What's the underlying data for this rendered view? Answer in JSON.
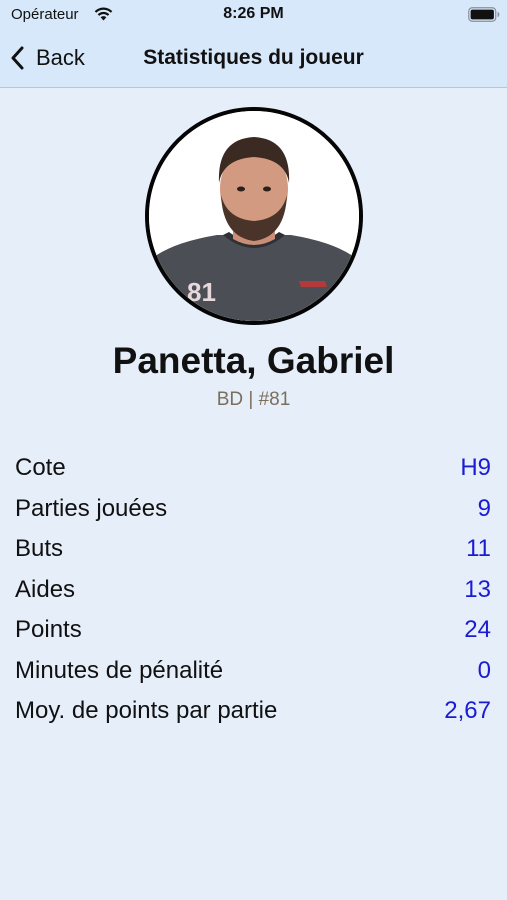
{
  "status_bar": {
    "carrier": "Opérateur",
    "time": "8:26 PM"
  },
  "nav": {
    "back_label": "Back",
    "title": "Statistiques du joueur"
  },
  "player": {
    "name": "Panetta, Gabriel",
    "subtitle": "BD | #81",
    "jersey_number": "81"
  },
  "stats": [
    {
      "label": "Cote",
      "value": "H9"
    },
    {
      "label": "Parties jouées",
      "value": "9"
    },
    {
      "label": "Buts",
      "value": "11"
    },
    {
      "label": "Aides",
      "value": "13"
    },
    {
      "label": "Points",
      "value": "24"
    },
    {
      "label": "Minutes de pénalité",
      "value": "0"
    },
    {
      "label": "Moy. de points par partie",
      "value": "2,67"
    }
  ],
  "colors": {
    "header_bg": "#d7e8fb",
    "page_bg": "#e6eefa",
    "value_color": "#1b1bd4",
    "subtitle_color": "#7a6f5a"
  }
}
